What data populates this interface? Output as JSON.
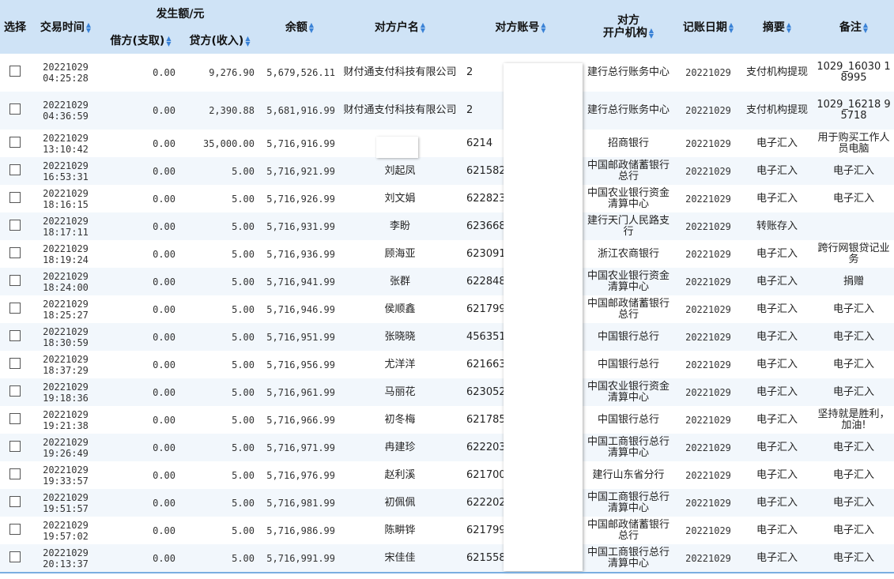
{
  "headers": {
    "select": "选择",
    "time": "交易时间",
    "amount_group": "发生额/元",
    "debit": "借方(支取)",
    "credit": "贷方(收入)",
    "balance": "余额",
    "counterparty_name": "对方户名",
    "counterparty_account": "对方账号",
    "counterparty_bank_l1": "对方",
    "counterparty_bank_l2": "开户机构",
    "post_date": "记账日期",
    "summary": "摘要",
    "remark": "备注"
  },
  "rows": [
    {
      "date": "20221029",
      "time": "04:25:28",
      "debit": "0.00",
      "credit": "9,276.90",
      "balance": "5,679,526.11",
      "name": "财付通支付科技有限公司",
      "account": "2",
      "bank": "建行总行账务中心",
      "post": "20221029",
      "summary": "支付机构提现",
      "remark": "1029_16030 18995"
    },
    {
      "date": "20221029",
      "time": "04:36:59",
      "debit": "0.00",
      "credit": "2,390.88",
      "balance": "5,681,916.99",
      "name": "财付通支付科技有限公司",
      "account": "2",
      "bank": "建行总行账务中心",
      "post": "20221029",
      "summary": "支付机构提现",
      "remark": "1029_16218 95718"
    },
    {
      "date": "20221029",
      "time": "13:10:42",
      "debit": "0.00",
      "credit": "35,000.00",
      "balance": "5,716,916.99",
      "name": "",
      "account": "6214",
      "bank": "招商银行",
      "post": "20221029",
      "summary": "电子汇入",
      "remark": "用于购买工作人员电脑"
    },
    {
      "date": "20221029",
      "time": "16:53:31",
      "debit": "0.00",
      "credit": "5.00",
      "balance": "5,716,921.99",
      "name": "刘起凤",
      "account": "621582",
      "bank": "中国邮政储蓄银行总行",
      "post": "20221029",
      "summary": "电子汇入",
      "remark": "电子汇入"
    },
    {
      "date": "20221029",
      "time": "18:16:15",
      "debit": "0.00",
      "credit": "5.00",
      "balance": "5,716,926.99",
      "name": "刘文娟",
      "account": "622823",
      "bank": "中国农业银行资金清算中心",
      "post": "20221029",
      "summary": "电子汇入",
      "remark": "电子汇入"
    },
    {
      "date": "20221029",
      "time": "18:17:11",
      "debit": "0.00",
      "credit": "5.00",
      "balance": "5,716,931.99",
      "name": "李盼",
      "account": "623668",
      "bank": "建行天门人民路支行",
      "post": "20221029",
      "summary": "转账存入",
      "remark": ""
    },
    {
      "date": "20221029",
      "time": "18:19:24",
      "debit": "0.00",
      "credit": "5.00",
      "balance": "5,716,936.99",
      "name": "顾海亚",
      "account": "623091",
      "bank": "浙江农商银行",
      "post": "20221029",
      "summary": "电子汇入",
      "remark": "跨行网银贷记业务"
    },
    {
      "date": "20221029",
      "time": "18:24:00",
      "debit": "0.00",
      "credit": "5.00",
      "balance": "5,716,941.99",
      "name": "张群",
      "account": "622848",
      "bank": "中国农业银行资金清算中心",
      "post": "20221029",
      "summary": "电子汇入",
      "remark": "捐赠"
    },
    {
      "date": "20221029",
      "time": "18:25:27",
      "debit": "0.00",
      "credit": "5.00",
      "balance": "5,716,946.99",
      "name": "侯顺鑫",
      "account": "621799",
      "bank": "中国邮政储蓄银行总行",
      "post": "20221029",
      "summary": "电子汇入",
      "remark": "电子汇入"
    },
    {
      "date": "20221029",
      "time": "18:30:59",
      "debit": "0.00",
      "credit": "5.00",
      "balance": "5,716,951.99",
      "name": "张晓晓",
      "account": "456351",
      "bank": "中国银行总行",
      "post": "20221029",
      "summary": "电子汇入",
      "remark": "电子汇入"
    },
    {
      "date": "20221029",
      "time": "18:37:29",
      "debit": "0.00",
      "credit": "5.00",
      "balance": "5,716,956.99",
      "name": "尤洋洋",
      "account": "621663",
      "bank": "中国银行总行",
      "post": "20221029",
      "summary": "电子汇入",
      "remark": "电子汇入"
    },
    {
      "date": "20221029",
      "time": "19:18:36",
      "debit": "0.00",
      "credit": "5.00",
      "balance": "5,716,961.99",
      "name": "马丽花",
      "account": "623052",
      "bank": "中国农业银行资金清算中心",
      "post": "20221029",
      "summary": "电子汇入",
      "remark": "电子汇入"
    },
    {
      "date": "20221029",
      "time": "19:21:38",
      "debit": "0.00",
      "credit": "5.00",
      "balance": "5,716,966.99",
      "name": "初冬梅",
      "account": "621785",
      "bank": "中国银行总行",
      "post": "20221029",
      "summary": "电子汇入",
      "remark": "坚持就是胜利，加油!"
    },
    {
      "date": "20221029",
      "time": "19:26:49",
      "debit": "0.00",
      "credit": "5.00",
      "balance": "5,716,971.99",
      "name": "冉建珍",
      "account": "622203",
      "bank": "中国工商银行总行清算中心",
      "post": "20221029",
      "summary": "电子汇入",
      "remark": "电子汇入"
    },
    {
      "date": "20221029",
      "time": "19:33:57",
      "debit": "0.00",
      "credit": "5.00",
      "balance": "5,716,976.99",
      "name": "赵利溪",
      "account": "621700",
      "bank": "建行山东省分行",
      "post": "20221029",
      "summary": "电子汇入",
      "remark": "电子汇入"
    },
    {
      "date": "20221029",
      "time": "19:51:57",
      "debit": "0.00",
      "credit": "5.00",
      "balance": "5,716,981.99",
      "name": "初佩佩",
      "account": "622202",
      "bank": "中国工商银行总行清算中心",
      "post": "20221029",
      "summary": "电子汇入",
      "remark": "电子汇入"
    },
    {
      "date": "20221029",
      "time": "19:57:02",
      "debit": "0.00",
      "credit": "5.00",
      "balance": "5,716,986.99",
      "name": "陈畊铧",
      "account": "621799",
      "bank": "中国邮政储蓄银行总行",
      "post": "20221029",
      "summary": "电子汇入",
      "remark": "电子汇入"
    },
    {
      "date": "20221029",
      "time": "20:13:37",
      "debit": "0.00",
      "credit": "5.00",
      "balance": "5,716,991.99",
      "name": "宋佳佳",
      "account": "621558",
      "bank": "中国工商银行总行清算中心",
      "post": "20221029",
      "summary": "电子汇入",
      "remark": "电子汇入"
    }
  ]
}
